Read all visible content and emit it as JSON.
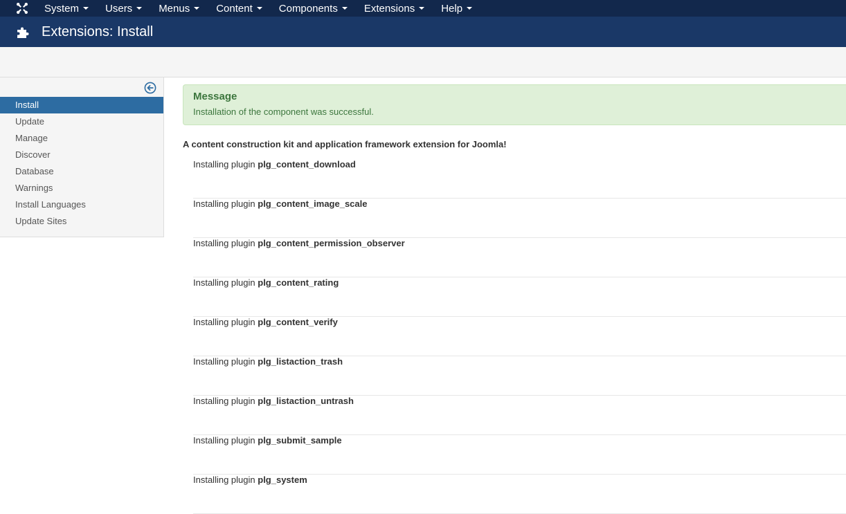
{
  "navbar": {
    "logo_icon": "joomla-logo-icon",
    "items": [
      {
        "label": "System"
      },
      {
        "label": "Users"
      },
      {
        "label": "Menus"
      },
      {
        "label": "Content"
      },
      {
        "label": "Components"
      },
      {
        "label": "Extensions"
      },
      {
        "label": "Help"
      }
    ]
  },
  "header": {
    "icon": "puzzle-piece-icon",
    "title": "Extensions: Install"
  },
  "sidebar": {
    "toggle_icon": "arrow-circle-left-icon",
    "items": [
      {
        "label": "Install",
        "active": true
      },
      {
        "label": "Update"
      },
      {
        "label": "Manage"
      },
      {
        "label": "Discover"
      },
      {
        "label": "Database"
      },
      {
        "label": "Warnings"
      },
      {
        "label": "Install Languages"
      },
      {
        "label": "Update Sites"
      }
    ]
  },
  "message": {
    "heading": "Message",
    "text": "Installation of the component was successful."
  },
  "extension_description": "A content construction kit and application framework extension for Joomla!",
  "plugins": [
    {
      "prefix": "Installing plugin",
      "name": "plg_content_download"
    },
    {
      "prefix": "Installing plugin",
      "name": "plg_content_image_scale"
    },
    {
      "prefix": "Installing plugin",
      "name": "plg_content_permission_observer"
    },
    {
      "prefix": "Installing plugin",
      "name": "plg_content_rating"
    },
    {
      "prefix": "Installing plugin",
      "name": "plg_content_verify"
    },
    {
      "prefix": "Installing plugin",
      "name": "plg_listaction_trash"
    },
    {
      "prefix": "Installing plugin",
      "name": "plg_listaction_untrash"
    },
    {
      "prefix": "Installing plugin",
      "name": "plg_submit_sample"
    },
    {
      "prefix": "Installing plugin",
      "name": "plg_system"
    }
  ],
  "colors": {
    "navbar_bg": "#12284c",
    "header_bg": "#1a3867",
    "active_item": "#2d6ca2",
    "success_bg": "#dff0d8",
    "success_text": "#3c763d"
  }
}
